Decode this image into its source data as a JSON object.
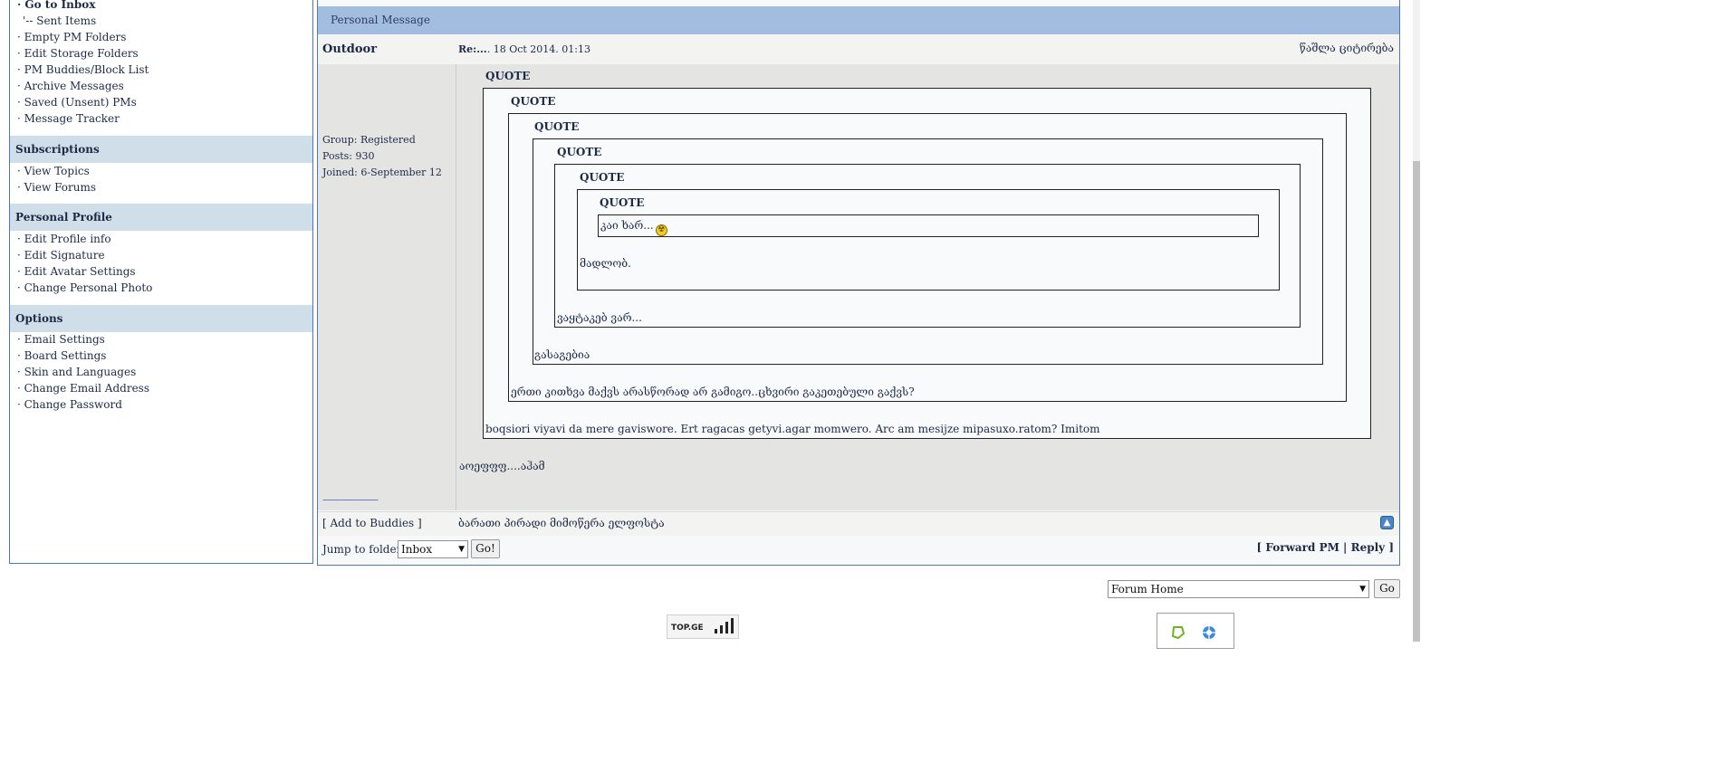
{
  "sidebar": {
    "inbox_items": [
      "· Go to Inbox",
      "'-- Sent Items",
      "· Empty PM Folders",
      "· Edit Storage Folders",
      "· PM Buddies/Block List",
      "· Archive Messages",
      "· Saved (Unsent) PMs",
      "· Message Tracker"
    ],
    "subscriptions": {
      "title": "Subscriptions",
      "items": [
        "· View Topics",
        "· View Forums"
      ]
    },
    "profile": {
      "title": "Personal Profile",
      "items": [
        "· Edit Profile info",
        "· Edit Signature",
        "· Edit Avatar Settings",
        "· Change Personal Photo"
      ]
    },
    "options": {
      "title": "Options",
      "items": [
        "· Email Settings",
        "· Board Settings",
        "· Skin and Languages",
        "· Change Email Address",
        "· Change Password"
      ]
    }
  },
  "message": {
    "title": "Personal Message",
    "author": "Outdoor",
    "subject": "Re:...",
    "date": ". 18 Oct 2014. 01:13",
    "tools": "წაშლა  ციტირება",
    "user_group": "Group: Registered",
    "user_posts": "Posts: 930",
    "user_joined": "Joined: 6-September 12",
    "quote_label": "QUOTE",
    "q6_text": "კაი ხარ...",
    "q5_text": "მადლობ.",
    "q4_text": "ვაყტაკებ ვარ...",
    "q3_text": "გასაგებია",
    "q2_text": "ერთი კითხვა მაქვს არასწორად არ გამიგო..ცხვირი გაკეთებული გაქვს?",
    "q1_text": "boqsiori viyavi da mere gaviswore. Ert ragacas getyvi.agar momwero. Arc am mesijze mipasuxo.ratom? Imitom",
    "reply_text": "აოეფფფ....აჰამ",
    "signature_line": "--------------------",
    "add_buddies": "[ Add to Buddies ]",
    "sender_signature": "ბარათი პირადი მიმოწერა ელფოსტა"
  },
  "jump": {
    "label": "Jump to folder:",
    "selected": "Inbox",
    "go": "Go!",
    "forward": "[ Forward PM |",
    "reply": "Reply ]"
  },
  "footer": {
    "forum_select": "Forum Home",
    "go": "Go",
    "topge_logo": "TOP.GE"
  },
  "colors": {
    "header_bar": "#a3bde0",
    "sidebar_section": "#d0deea",
    "border": "#5176b5"
  }
}
